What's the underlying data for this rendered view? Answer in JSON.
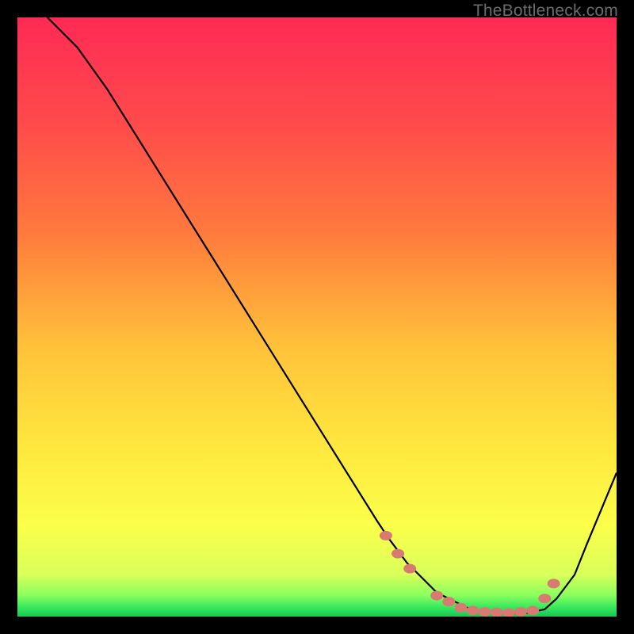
{
  "watermark": "TheBottleneck.com",
  "chart_data": {
    "type": "line",
    "title": "",
    "xlabel": "",
    "ylabel": "",
    "xlim": [
      0,
      100
    ],
    "ylim": [
      0,
      100
    ],
    "grid": false,
    "legend": false,
    "series": [
      {
        "name": "bottleneck-curve",
        "color": "#000000",
        "x": [
          5,
          10,
          15,
          20,
          25,
          30,
          35,
          40,
          45,
          50,
          55,
          60,
          62,
          65,
          68,
          70,
          73,
          75,
          78,
          80,
          83,
          85,
          88,
          90,
          93,
          95,
          100
        ],
        "y": [
          100,
          95,
          88,
          80,
          72,
          64,
          56,
          48,
          40,
          32,
          24,
          16,
          13,
          9,
          6,
          4,
          2.5,
          1.5,
          0.8,
          0.5,
          0.5,
          0.6,
          1.2,
          3,
          7,
          12,
          24
        ]
      }
    ],
    "markers": {
      "name": "highlight-dots",
      "color": "#d97a72",
      "x": [
        61.5,
        63.5,
        65.5,
        70,
        72,
        74,
        76,
        78,
        80,
        82,
        84,
        86,
        88,
        89.5
      ],
      "y": [
        13.5,
        10.5,
        8.0,
        3.5,
        2.5,
        1.5,
        1.0,
        0.8,
        0.7,
        0.6,
        0.8,
        1.0,
        3.0,
        5.5
      ]
    },
    "gradient_stops": [
      {
        "offset": 0.0,
        "color": "#ff2a55"
      },
      {
        "offset": 0.18,
        "color": "#ff4b4b"
      },
      {
        "offset": 0.36,
        "color": "#ff7a3d"
      },
      {
        "offset": 0.55,
        "color": "#ffc23a"
      },
      {
        "offset": 0.72,
        "color": "#ffe83e"
      },
      {
        "offset": 0.85,
        "color": "#fbff4a"
      },
      {
        "offset": 0.93,
        "color": "#d9ff5a"
      },
      {
        "offset": 0.965,
        "color": "#88ff5e"
      },
      {
        "offset": 0.985,
        "color": "#35e85e"
      },
      {
        "offset": 1.0,
        "color": "#18c653"
      }
    ]
  }
}
